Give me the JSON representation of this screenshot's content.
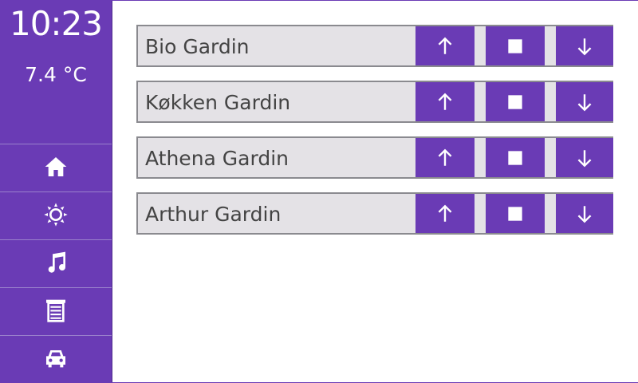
{
  "status": {
    "time": "10:23",
    "temperature": "7.4 °C"
  },
  "nav": [
    {
      "icon": "home-icon"
    },
    {
      "icon": "sun-settings-icon"
    },
    {
      "icon": "music-icon"
    },
    {
      "icon": "blinds-icon"
    },
    {
      "icon": "car-icon"
    }
  ],
  "curtains": [
    {
      "label": "Bio Gardin"
    },
    {
      "label": "Køkken Gardin"
    },
    {
      "label": "Athena Gardin"
    },
    {
      "label": "Arthur Gardin"
    }
  ],
  "controls": {
    "up_icon": "arrow-up-icon",
    "stop_icon": "stop-icon",
    "down_icon": "arrow-down-icon"
  },
  "colors": {
    "accent": "#6a3bb5",
    "row_bg": "#e4e2e6",
    "row_border": "#8a8a8f",
    "content_bg": "#ffffff"
  }
}
